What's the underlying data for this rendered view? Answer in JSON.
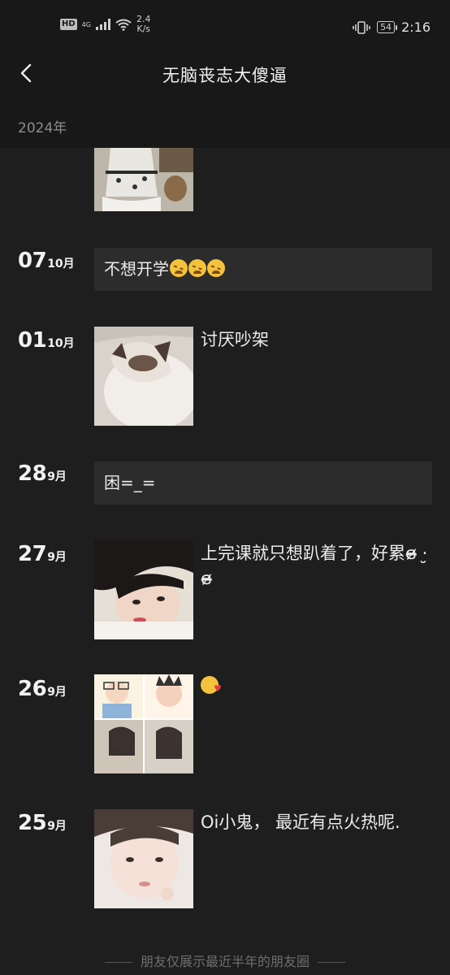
{
  "status_bar": {
    "hd": "HD",
    "network": "4G",
    "speed": "2.4",
    "speed_unit": "K/s",
    "battery": "54",
    "time": "2:16"
  },
  "nav": {
    "title": "无脑丧志大傻逼",
    "back_icon": "chevron-left-icon"
  },
  "year_header": "2024年",
  "posts": [
    {
      "day": "07",
      "month": "10月",
      "type": "text",
      "text": "不想开学",
      "emoji": [
        "crying-face",
        "crying-face",
        "crying-face"
      ]
    },
    {
      "day": "01",
      "month": "10月",
      "type": "image",
      "caption": "讨厌吵架"
    },
    {
      "day": "28",
      "month": "9月",
      "type": "text",
      "text": "困=_="
    },
    {
      "day": "27",
      "month": "9月",
      "type": "image",
      "caption": "上完课就只想趴着了，好累ɞ̴̶̷ ·̮ ɞ̴̶̷"
    },
    {
      "day": "26",
      "month": "9月",
      "type": "image",
      "caption": "",
      "emoji": "kissing-face"
    },
    {
      "day": "25",
      "month": "9月",
      "type": "image",
      "caption": "Oi小鬼， 最近有点火热呢."
    }
  ],
  "footer": "朋友仅展示最近半年的朋友圈"
}
